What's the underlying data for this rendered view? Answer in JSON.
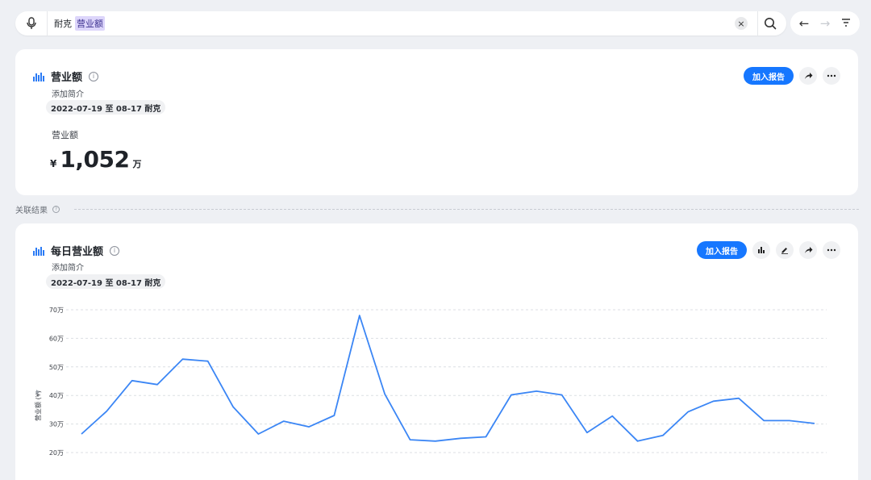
{
  "search": {
    "tokens": [
      {
        "text": "耐克",
        "highlight": false
      },
      {
        "text": "营业额",
        "highlight": true
      }
    ],
    "clear_glyph": "×"
  },
  "nav": {
    "back": "←",
    "forward": "→",
    "filter": "filter-icon"
  },
  "summary_card": {
    "title": "营业额",
    "description": "添加简介",
    "date_chip": "2022-07-19 至 08-17 耐克",
    "metric_label": "营业额",
    "currency": "¥",
    "value": "1,052",
    "unit": "万",
    "add_report_label": "加入报告"
  },
  "related": {
    "label": "关联结果"
  },
  "chart_card": {
    "title": "每日营业额",
    "description": "添加简介",
    "date_chip": "2022-07-19 至 08-17 耐克",
    "add_report_label": "加入报告"
  },
  "chart_data": {
    "type": "line",
    "ylabel": "营业额 (¥)",
    "y_ticks": [
      "20万",
      "30万",
      "40万",
      "50万",
      "60万",
      "70万"
    ],
    "ylim": [
      20,
      70
    ],
    "grid": true,
    "series": [
      {
        "color": "#3b86f5",
        "values": [
          26.5,
          34.5,
          45.2,
          43.8,
          52.7,
          52.0,
          36.0,
          26.5,
          31.0,
          29.0,
          33.0,
          68.0,
          40.5,
          24.5,
          24.0,
          25.0,
          25.5,
          40.2,
          41.5,
          40.2,
          27.0,
          32.8,
          24.0,
          26.0,
          34.3,
          38.0,
          39.0,
          31.2,
          31.2,
          30.2
        ]
      }
    ]
  }
}
